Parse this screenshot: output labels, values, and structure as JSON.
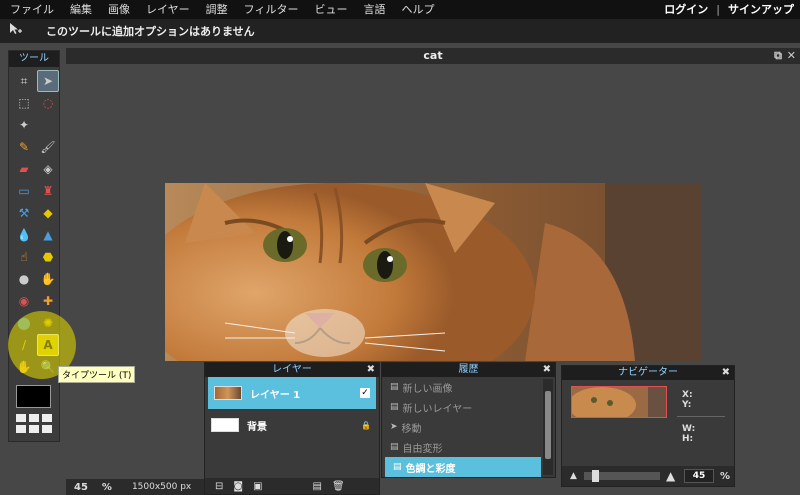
{
  "menubar": {
    "items": [
      "ファイル",
      "編集",
      "画像",
      "レイヤー",
      "調整",
      "フィルター",
      "ビュー",
      "言語",
      "ヘルプ"
    ],
    "login": "ログイン",
    "separator": "|",
    "signup": "サインアップ"
  },
  "options_bar": {
    "message": "このツールに追加オプションはありません"
  },
  "tools": {
    "title": "ツール",
    "tooltip": "タイプツール (T)",
    "type_tool_glyph": "A",
    "foreground_color": "#000000"
  },
  "document": {
    "title": "cat",
    "zoom": "45",
    "zoom_unit": "%",
    "dimensions": "1500x500 px"
  },
  "layers": {
    "title": "レイヤー",
    "items": [
      {
        "name": "レイヤー 1",
        "visible_mark": "✓"
      },
      {
        "name": "背景",
        "lock_mark": "🔒"
      }
    ]
  },
  "history": {
    "title": "履歴",
    "items": [
      "新しい画像",
      "新しいレイヤー",
      "移動",
      "自由変形",
      "色調と彩度"
    ]
  },
  "navigator": {
    "title": "ナビゲーター",
    "x_label": "X:",
    "y_label": "Y:",
    "w_label": "W:",
    "h_label": "H:",
    "zoom": "45",
    "zoom_unit": "%",
    "slider_level": 0.12
  },
  "colors": {
    "accent": "#5bc0de",
    "panel_title": "#8fd1ff",
    "highlight": "#e6d200"
  }
}
